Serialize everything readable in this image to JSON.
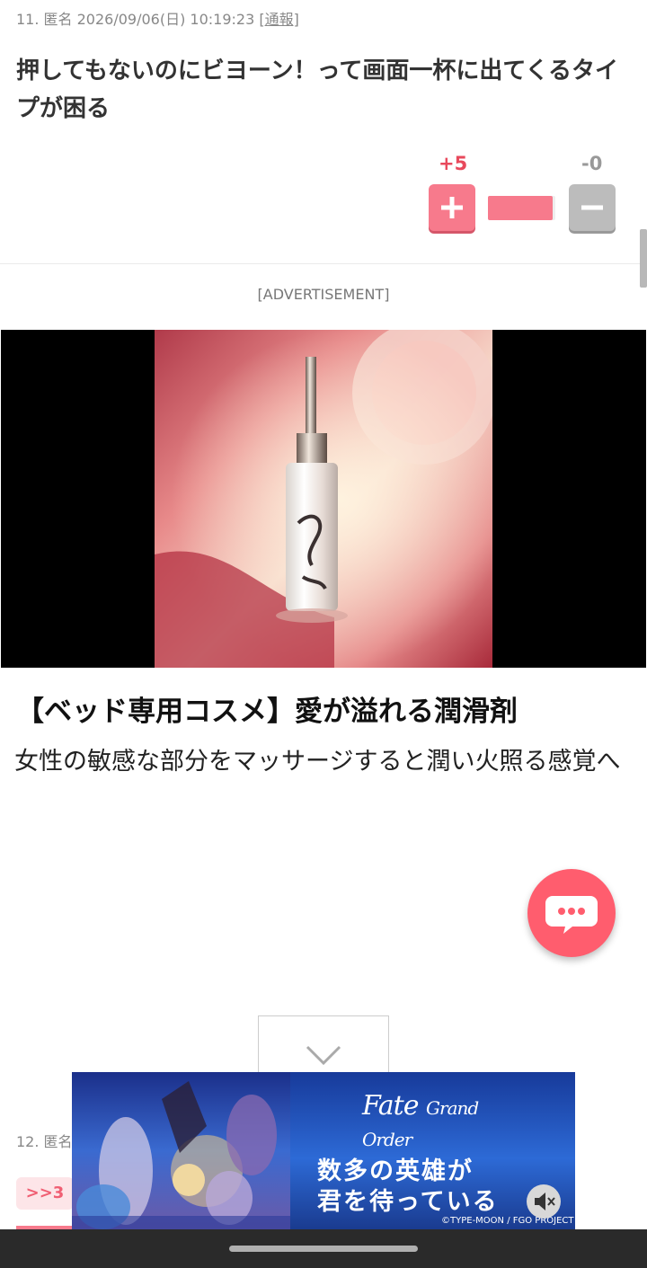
{
  "comment11": {
    "meta": "11. 匿名 2026/09/06(日) 10:19:23 ",
    "report_link": "[通報]",
    "body": "押してもないのにビヨーン！って画面一杯に出てくるタイプが困る",
    "plus_count": "+5",
    "minus_count": "-0",
    "plus_ratio": 1.0
  },
  "advertisement": {
    "label": "[ADVERTISEMENT]",
    "title": "【ベッド専用コスメ】愛が溢れる潤滑剤",
    "description": "女性の敏感な部分をマッサージすると潤い火照る感覚へ"
  },
  "comment12": {
    "meta": "12. 匿名",
    "reply_badge": ">>3"
  },
  "banner": {
    "logo_line1": "Fate",
    "logo_line2": "Grand Order",
    "tagline1": "数多の英雄が",
    "tagline2": "君を待っている",
    "copyright": "©TYPE-MOON / FGO PROJECT"
  },
  "colors": {
    "accent_pink": "#f77a8c",
    "plus_red": "#e8495c",
    "chat_button": "#ff5d6e"
  },
  "icons": [
    "plus-icon",
    "minus-icon",
    "chat-bubble-icon",
    "chevron-down-icon",
    "info-icon",
    "mute-icon"
  ]
}
